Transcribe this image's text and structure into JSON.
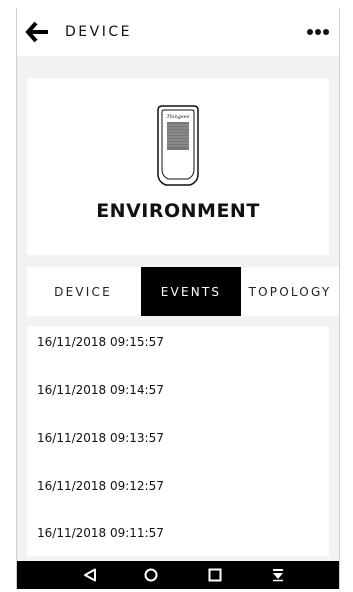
{
  "header": {
    "title": "DEVICE",
    "back_icon": "arrow-left-icon",
    "menu_icon": "more-horizontal-icon"
  },
  "device": {
    "brand_text": "Thingsee",
    "name": "ENVIRONMENT"
  },
  "tabs": [
    {
      "label": "DEVICE",
      "active": false
    },
    {
      "label": "EVENTS",
      "active": true
    },
    {
      "label": "TOPOLOGY",
      "active": false
    }
  ],
  "events": [
    {
      "timestamp": "16/11/2018 09:15:57"
    },
    {
      "timestamp": "16/11/2018 09:14:57"
    },
    {
      "timestamp": "16/11/2018 09:13:57"
    },
    {
      "timestamp": "16/11/2018 09:12:57"
    },
    {
      "timestamp": "16/11/2018 09:11:57"
    }
  ],
  "navbar": {
    "icons": [
      "back-triangle-icon",
      "home-circle-icon",
      "recents-square-icon",
      "notifications-down-icon"
    ]
  }
}
